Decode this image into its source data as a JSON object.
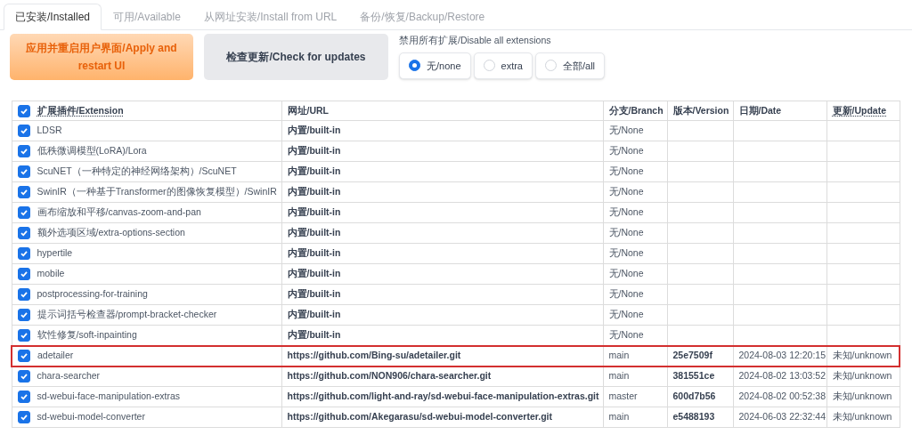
{
  "tabs": [
    {
      "label": "已安装/Installed",
      "selected": true
    },
    {
      "label": "可用/Available",
      "selected": false
    },
    {
      "label": "从网址安装/Install from URL",
      "selected": false
    },
    {
      "label": "备份/恢复/Backup/Restore",
      "selected": false
    }
  ],
  "apply_button": "应用并重启用户界面/Apply and restart UI",
  "check_button": "检查更新/Check for updates",
  "disable_group": {
    "label": "禁用所有扩展/Disable all extensions",
    "options": [
      {
        "label": "无/none",
        "selected": true
      },
      {
        "label": "extra",
        "selected": false
      },
      {
        "label": "全部/all",
        "selected": false
      }
    ]
  },
  "table": {
    "header_checked": true,
    "columns": [
      {
        "label": "扩展插件/Extension",
        "underlined": true
      },
      {
        "label": "网址/URL",
        "underlined": false
      },
      {
        "label": "分支/Branch",
        "underlined": false
      },
      {
        "label": "版本/Version",
        "underlined": false
      },
      {
        "label": "日期/Date",
        "underlined": false
      },
      {
        "label": "更新/Update",
        "underlined": true
      }
    ],
    "rows": [
      {
        "checked": true,
        "highlighted": false,
        "name": "LDSR",
        "url": "内置/built-in",
        "branch": "无/None"
      },
      {
        "checked": true,
        "highlighted": false,
        "name": "低秩微调模型(LoRA)/Lora",
        "url": "内置/built-in",
        "branch": "无/None"
      },
      {
        "checked": true,
        "highlighted": false,
        "name": "ScuNET（一种特定的神经网络架构）/ScuNET",
        "url": "内置/built-in",
        "branch": "无/None"
      },
      {
        "checked": true,
        "highlighted": false,
        "name": "SwinIR（一种基于Transformer的图像恢复模型）/SwinIR",
        "url": "内置/built-in",
        "branch": "无/None"
      },
      {
        "checked": true,
        "highlighted": false,
        "name": "画布缩放和平移/canvas-zoom-and-pan",
        "url": "内置/built-in",
        "branch": "无/None"
      },
      {
        "checked": true,
        "highlighted": false,
        "name": "额外选项区域/extra-options-section",
        "url": "内置/built-in",
        "branch": "无/None"
      },
      {
        "checked": true,
        "highlighted": false,
        "name": "hypertile",
        "url": "内置/built-in",
        "branch": "无/None"
      },
      {
        "checked": true,
        "highlighted": false,
        "name": "mobile",
        "url": "内置/built-in",
        "branch": "无/None"
      },
      {
        "checked": true,
        "highlighted": false,
        "name": "postprocessing-for-training",
        "url": "内置/built-in",
        "branch": "无/None"
      },
      {
        "checked": true,
        "highlighted": false,
        "name": "提示词括号检查器/prompt-bracket-checker",
        "url": "内置/built-in",
        "branch": "无/None"
      },
      {
        "checked": true,
        "highlighted": false,
        "name": "软性修复/soft-inpainting",
        "url": "内置/built-in",
        "branch": "无/None"
      },
      {
        "checked": true,
        "highlighted": true,
        "name": "adetailer",
        "url": "https://github.com/Bing-su/adetailer.git",
        "branch": "main",
        "version": "25e7509f",
        "date": "2024-08-03 12:20:15",
        "update": "未知/unknown"
      },
      {
        "checked": true,
        "highlighted": false,
        "name": "chara-searcher",
        "url": "https://github.com/NON906/chara-searcher.git",
        "branch": "main",
        "version": "381551ce",
        "date": "2024-08-02 13:03:52",
        "update": "未知/unknown"
      },
      {
        "checked": true,
        "highlighted": false,
        "name": "sd-webui-face-manipulation-extras",
        "url": "https://github.com/light-and-ray/sd-webui-face-manipulation-extras.git",
        "branch": "master",
        "version": "600d7b56",
        "date": "2024-08-02 00:52:38",
        "update": "未知/unknown"
      },
      {
        "checked": true,
        "highlighted": false,
        "name": "sd-webui-model-converter",
        "url": "https://github.com/Akegarasu/sd-webui-model-converter.git",
        "branch": "main",
        "version": "e5488193",
        "date": "2024-06-03 22:32:44",
        "update": "未知/unknown"
      }
    ]
  }
}
